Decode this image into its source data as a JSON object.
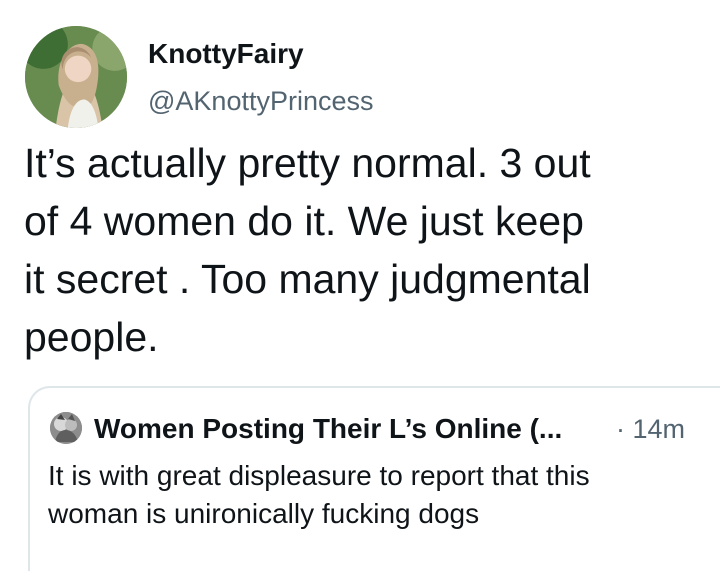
{
  "tweet": {
    "author": {
      "display_name": "KnottyFairy",
      "handle": "@AKnottyPrincess",
      "avatar_icon": "profile-photo-avatar"
    },
    "text_lines": [
      "It’s actually pretty normal. 3 out",
      "of 4 women do it. We just keep",
      "it secret . Too many judgmental",
      "people."
    ]
  },
  "quoted_tweet": {
    "author": {
      "display_name": "Women Posting Their L’s Online (...",
      "avatar_icon": "profile-photo-avatar"
    },
    "time_separator": "·",
    "time": "14m",
    "text_lines": [
      "It is with great displeasure to report that this",
      "woman is unironically fucking dogs"
    ]
  },
  "colors": {
    "background": "#ffffff",
    "primary_text": "#0f1419",
    "secondary_text": "#536471",
    "border": "#dfe6ea"
  }
}
